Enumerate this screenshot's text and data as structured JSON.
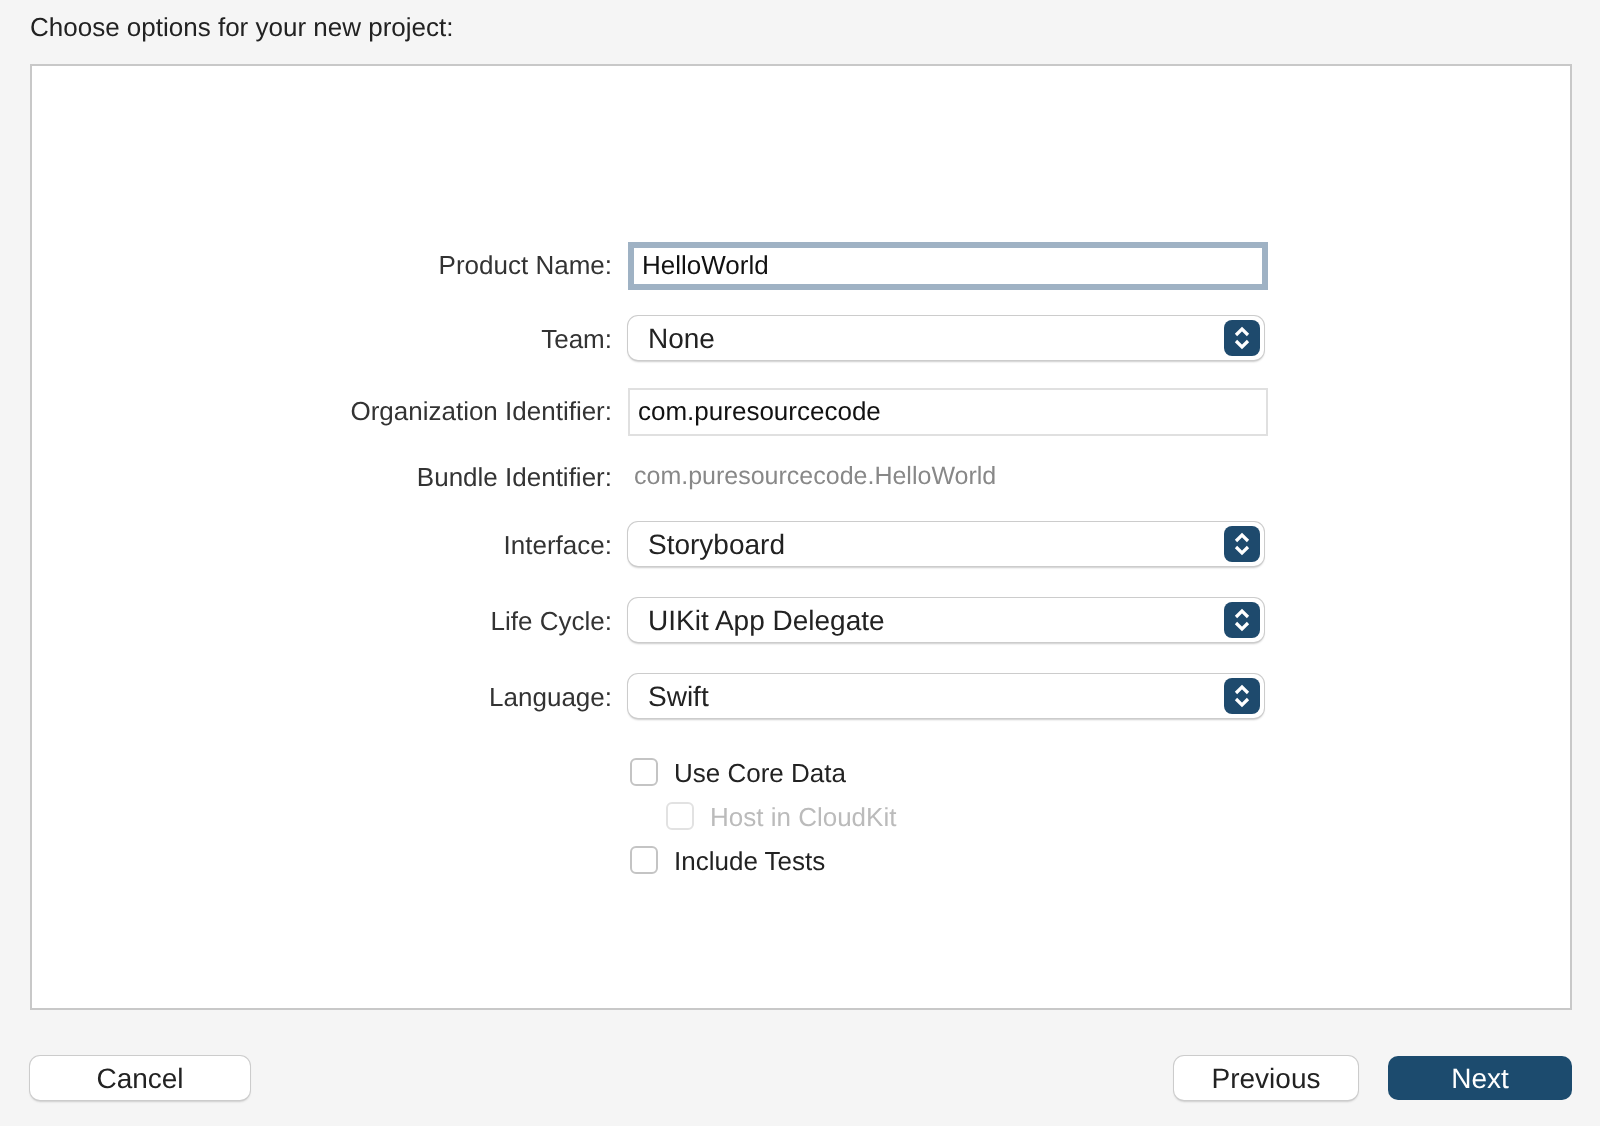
{
  "heading": "Choose options for your new project:",
  "fields": [
    {
      "kind": "text",
      "label": "Product Name:",
      "value": "HelloWorld",
      "focused": true
    },
    {
      "kind": "popup",
      "label": "Team:",
      "value": "None"
    },
    {
      "kind": "text",
      "label": "Organization Identifier:",
      "value": "com.puresourcecode",
      "focused": false
    },
    {
      "kind": "static",
      "label": "Bundle Identifier:",
      "value": "com.puresourcecode.HelloWorld"
    },
    {
      "kind": "popup",
      "label": "Interface:",
      "value": "Storyboard"
    },
    {
      "kind": "popup",
      "label": "Life Cycle:",
      "value": "UIKit App Delegate"
    },
    {
      "kind": "popup",
      "label": "Language:",
      "value": "Swift"
    }
  ],
  "options": [
    {
      "label": "Use Core Data",
      "checked": false,
      "disabled": false,
      "children": [
        {
          "label": "Host in CloudKit",
          "checked": false,
          "disabled": true
        }
      ]
    },
    {
      "label": "Include Tests",
      "checked": false,
      "disabled": false
    }
  ],
  "buttons": [
    {
      "label": "Cancel",
      "kind": "cancel"
    },
    {
      "label": "Previous",
      "kind": "normal"
    },
    {
      "label": "Next",
      "kind": "default"
    }
  ]
}
